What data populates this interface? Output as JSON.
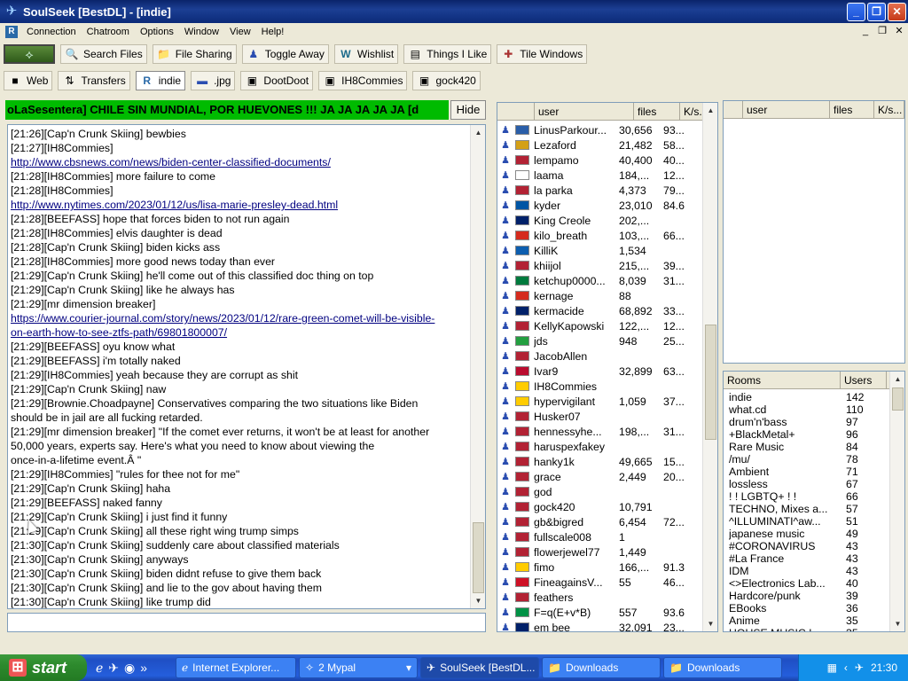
{
  "window": {
    "title": "SoulSeek [BestDL] - [indie]",
    "icon": "soulseek-bird-icon"
  },
  "menu": [
    "Connection",
    "Chatroom",
    "Options",
    "Window",
    "View",
    "Help!"
  ],
  "toolbar1": [
    {
      "label": "Search Files",
      "icon": "binoculars-icon"
    },
    {
      "label": "File Sharing",
      "icon": "folder-icon"
    },
    {
      "label": "Toggle Away",
      "icon": "user-away-icon"
    },
    {
      "label": "Wishlist",
      "icon": "wishlist-icon"
    },
    {
      "label": "Things I Like",
      "icon": "things-icon"
    },
    {
      "label": "Tile Windows",
      "icon": "tile-icon"
    }
  ],
  "toolbar2": [
    {
      "label": "Web",
      "icon": "web-icon",
      "active": false
    },
    {
      "label": "Transfers",
      "icon": "transfers-icon",
      "active": false
    },
    {
      "label": "indie",
      "icon": "room-icon",
      "active": true
    },
    {
      "label": ".jpg",
      "icon": "user-icon",
      "active": false
    },
    {
      "label": "DootDoot",
      "icon": "room-icon",
      "active": false
    },
    {
      "label": "IH8Commies",
      "icon": "room-icon",
      "active": false
    },
    {
      "label": "gock420",
      "icon": "room-icon",
      "active": false
    }
  ],
  "chat": {
    "topic": "oLaSesentera] CHILE SIN MUNDIAL, POR HUEVONES !!! JA JA JA JA JA      [d",
    "hide_label": "Hide",
    "lines": [
      {
        "text": "[21:26][Cap'n Crunk Skiing] bewbies",
        "link": false
      },
      {
        "text": "[21:27][IH8Commies]",
        "link": false
      },
      {
        "text": "http://www.cbsnews.com/news/biden-center-classified-documents/",
        "link": true
      },
      {
        "text": "[21:28][IH8Commies] more failure to come",
        "link": false
      },
      {
        "text": "[21:28][IH8Commies]",
        "link": false
      },
      {
        "text": "http://www.nytimes.com/2023/01/12/us/lisa-marie-presley-dead.html",
        "link": true
      },
      {
        "text": "[21:28][BEEFASS] hope that forces biden to not run again",
        "link": false
      },
      {
        "text": "[21:28][IH8Commies] elvis daughter is dead",
        "link": false
      },
      {
        "text": "[21:28][Cap'n Crunk Skiing] biden kicks ass",
        "link": false
      },
      {
        "text": "[21:28][IH8Commies] more good news today than ever",
        "link": false
      },
      {
        "text": "[21:29][Cap'n Crunk Skiing] he'll come out of this classified doc thing on top",
        "link": false
      },
      {
        "text": "[21:29][Cap'n Crunk Skiing] like he always has",
        "link": false
      },
      {
        "text": "[21:29][mr dimension breaker]",
        "link": false
      },
      {
        "text": "https://www.courier-journal.com/story/news/2023/01/12/rare-green-comet-will-be-visible-",
        "link": true
      },
      {
        "text": "on-earth-how-to-see-ztfs-path/69801800007/",
        "link": true
      },
      {
        "text": "[21:29][BEEFASS] oyu know what",
        "link": false
      },
      {
        "text": "[21:29][BEEFASS] i'm totally naked",
        "link": false
      },
      {
        "text": "[21:29][IH8Commies] yeah because they are corrupt as shit",
        "link": false
      },
      {
        "text": "[21:29][Cap'n Crunk Skiing] naw",
        "link": false
      },
      {
        "text": "[21:29][Brownie.Choadpayne] Conservatives comparing the two situations like Biden",
        "link": false
      },
      {
        "text": "should be in jail are all fucking retarded.",
        "link": false
      },
      {
        "text": "[21:29][mr dimension breaker] \"If the comet ever returns, it won't be at least for another",
        "link": false
      },
      {
        "text": "50,000 years, experts say. Here's what you need to know about viewing the",
        "link": false
      },
      {
        "text": "once-in-a-lifetime event.Â \"",
        "link": false
      },
      {
        "text": "[21:29][IH8Commies] \"rules for thee not for me\"",
        "link": false
      },
      {
        "text": "[21:29][Cap'n Crunk Skiing] haha",
        "link": false
      },
      {
        "text": "[21:29][BEEFASS] naked fanny",
        "link": false
      },
      {
        "text": "[21:29][Cap'n Crunk Skiing] i just find it funny",
        "link": false
      },
      {
        "text": "[21:29][Cap'n Crunk Skiing] all these right wing trump simps",
        "link": false
      },
      {
        "text": "[21:30][Cap'n Crunk Skiing] suddenly care about classified materials",
        "link": false
      },
      {
        "text": "[21:30][Cap'n Crunk Skiing] anyways",
        "link": false
      },
      {
        "text": "[21:30][Cap'n Crunk Skiing] biden didnt refuse to give them back",
        "link": false
      },
      {
        "text": "[21:30][Cap'n Crunk Skiing] and lie to the gov about having them",
        "link": false
      },
      {
        "text": "[21:30][Cap'n Crunk Skiing] like trump did",
        "link": false
      }
    ]
  },
  "userlist": {
    "columns": [
      "user",
      "files",
      "K/s..."
    ],
    "users": [
      {
        "name": "LinusParkour...",
        "files": "30,656",
        "speed": "93...",
        "flag": "#2a5ea8"
      },
      {
        "name": "Lezaford",
        "files": "21,482",
        "speed": "58...",
        "flag": "#d4a017"
      },
      {
        "name": "lempamo",
        "files": "40,400",
        "speed": "40...",
        "flag": "#b22234"
      },
      {
        "name": "laama",
        "files": "184,...",
        "speed": "12...",
        "flag": "#ffffff"
      },
      {
        "name": "la parka",
        "files": "4,373",
        "speed": "79...",
        "flag": "#b22234"
      },
      {
        "name": "kyder",
        "files": "23,010",
        "speed": "84.6",
        "flag": "#0055a4"
      },
      {
        "name": "King Creole",
        "files": "202,...",
        "speed": "",
        "flag": "#012169"
      },
      {
        "name": "kilo_breath",
        "files": "103,...",
        "speed": "66...",
        "flag": "#d52b1e"
      },
      {
        "name": "KilliK",
        "files": "1,534",
        "speed": "",
        "flag": "#0d5eaf"
      },
      {
        "name": "khiijol",
        "files": "215,...",
        "speed": "39...",
        "flag": "#b22234"
      },
      {
        "name": "ketchup0000...",
        "files": "8,039",
        "speed": "31...",
        "flag": "#007a3d"
      },
      {
        "name": "kernage",
        "files": "88",
        "speed": "",
        "flag": "#d52b1e"
      },
      {
        "name": "kermacide",
        "files": "68,892",
        "speed": "33...",
        "flag": "#012169"
      },
      {
        "name": "KellyKapowski",
        "files": "122,...",
        "speed": "12...",
        "flag": "#b22234"
      },
      {
        "name": "jds",
        "files": "948",
        "speed": "25...",
        "flag": "#239f40"
      },
      {
        "name": "JacobAllen",
        "files": "",
        "speed": "",
        "flag": "#b22234"
      },
      {
        "name": "Ivar9",
        "files": "32,899",
        "speed": "63...",
        "flag": "#ba0c2f"
      },
      {
        "name": "IH8Commies",
        "files": "",
        "speed": "",
        "flag": "#ffcc00"
      },
      {
        "name": "hypervigilant",
        "files": "1,059",
        "speed": "37...",
        "flag": "#ffcc00"
      },
      {
        "name": "Husker07",
        "files": "",
        "speed": "",
        "flag": "#b22234"
      },
      {
        "name": "hennessyhe...",
        "files": "198,...",
        "speed": "31...",
        "flag": "#b22234"
      },
      {
        "name": "haruspexfakey",
        "files": "",
        "speed": "",
        "flag": "#b22234"
      },
      {
        "name": "hanky1k",
        "files": "49,665",
        "speed": "15...",
        "flag": "#b22234"
      },
      {
        "name": "grace",
        "files": "2,449",
        "speed": "20...",
        "flag": "#b22234"
      },
      {
        "name": "god",
        "files": "",
        "speed": "",
        "flag": "#b22234"
      },
      {
        "name": "gock420",
        "files": "10,791",
        "speed": "",
        "flag": "#b22234"
      },
      {
        "name": "gb&bigred",
        "files": "6,454",
        "speed": "72...",
        "flag": "#b22234"
      },
      {
        "name": "fullscale008",
        "files": "1",
        "speed": "",
        "flag": "#b22234"
      },
      {
        "name": "flowerjewel77",
        "files": "1,449",
        "speed": "",
        "flag": "#b22234"
      },
      {
        "name": "fimo",
        "files": "166,...",
        "speed": "91.3",
        "flag": "#ffcc00"
      },
      {
        "name": "FineagainsV...",
        "files": "55",
        "speed": "46...",
        "flag": "#ce1126"
      },
      {
        "name": "feathers",
        "files": "",
        "speed": "",
        "flag": "#b22234"
      },
      {
        "name": "F=q(E+v*B)",
        "files": "557",
        "speed": "93.6",
        "flag": "#009246"
      },
      {
        "name": "em bee",
        "files": "32,091",
        "speed": "23...",
        "flag": "#012169"
      }
    ]
  },
  "right_top": {
    "columns": [
      "user",
      "files",
      "K/s..."
    ]
  },
  "rooms": {
    "columns": [
      "Rooms",
      "Users"
    ],
    "items": [
      {
        "name": "indie",
        "users": "142"
      },
      {
        "name": "what.cd",
        "users": "110"
      },
      {
        "name": "drum'n'bass",
        "users": "97"
      },
      {
        "name": "+BlackMetal+",
        "users": "96"
      },
      {
        "name": "Rare Music",
        "users": "84"
      },
      {
        "name": "/mu/",
        "users": "78"
      },
      {
        "name": "Ambient",
        "users": "71"
      },
      {
        "name": "lossless",
        "users": "67"
      },
      {
        "name": "! ! LGBTQ+ ! !",
        "users": "66"
      },
      {
        "name": "TECHNO, Mixes a...",
        "users": "57"
      },
      {
        "name": "^ILLUMINATI^aw...",
        "users": "51"
      },
      {
        "name": "japanese music",
        "users": "49"
      },
      {
        "name": "#CORONAVIRUS",
        "users": "43"
      },
      {
        "name": "#La France",
        "users": "43"
      },
      {
        "name": "IDM",
        "users": "43"
      },
      {
        "name": "<>Electronics Lab...",
        "users": "40"
      },
      {
        "name": "Hardcore/punk",
        "users": "39"
      },
      {
        "name": "EBooks",
        "users": "36"
      },
      {
        "name": "Anime",
        "users": "35"
      },
      {
        "name": "HOUSE MUSIC !",
        "users": "35"
      }
    ]
  },
  "taskbar": {
    "start_label": "start",
    "tasks": [
      {
        "label": "Internet Explorer...",
        "icon": "ie-icon",
        "active": false
      },
      {
        "label": "2 Mypal",
        "icon": "mypal-icon",
        "active": false
      },
      {
        "label": "SoulSeek [BestDL...",
        "icon": "soulseek-icon",
        "active": true
      },
      {
        "label": "Downloads",
        "icon": "folder-icon",
        "active": false
      },
      {
        "label": "Downloads",
        "icon": "folder-icon",
        "active": false
      }
    ],
    "clock": "21:30"
  }
}
